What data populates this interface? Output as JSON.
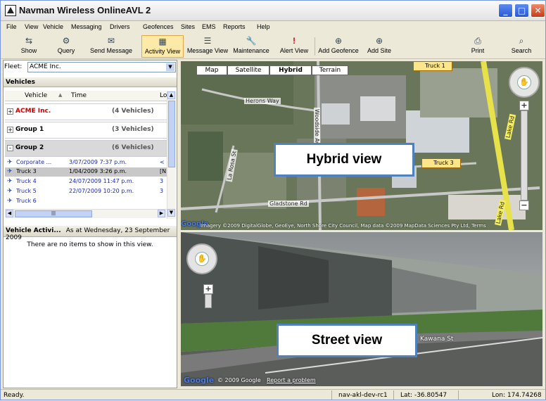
{
  "app": {
    "title": "Navman Wireless OnlineAVL 2"
  },
  "menu": {
    "items": [
      "File",
      "View",
      "Vehicle",
      "Messaging",
      "Drivers",
      "Geofences",
      "Sites",
      "EMS",
      "Reports",
      "Help"
    ]
  },
  "toolbar": {
    "show": "Show",
    "query": "Query",
    "send_message": "Send Message",
    "activity_view": "Activity View",
    "message_view": "Message View",
    "maintenance": "Maintenance",
    "alert_view": "Alert View",
    "add_geofence": "Add Geofence",
    "add_site": "Add Site",
    "print": "Print",
    "search": "Search"
  },
  "fleet": {
    "label": "Fleet:",
    "value": "ACME Inc."
  },
  "vehicles": {
    "header": "Vehicles",
    "columns": {
      "vehicle": "Vehicle",
      "time": "Time",
      "loc": "Lo"
    },
    "groups": [
      {
        "name": "ACME Inc.",
        "count": "(4 Vehicles)",
        "toggle": "+"
      },
      {
        "name": "Group 1",
        "count": "(3 Vehicles)",
        "toggle": "+"
      },
      {
        "name": "Group 2",
        "count": "(6 Vehicles)",
        "toggle": "–"
      }
    ],
    "rows": [
      {
        "name": "Corporate ...",
        "time": "3/07/2009 7:37 p.m.",
        "loc": "<"
      },
      {
        "name": "Truck 3",
        "time": "1/04/2009 3:26 p.m.",
        "loc": "[N"
      },
      {
        "name": "Truck 4",
        "time": "24/07/2009 11:47 p.m.",
        "loc": "3"
      },
      {
        "name": "Truck 5",
        "time": "22/07/2009 10:20 p.m.",
        "loc": "3"
      },
      {
        "name": "Truck 6",
        "time": "",
        "loc": ""
      }
    ]
  },
  "activity": {
    "header": "Vehicle Activi...",
    "as_at": "As at Wednesday, 23 September 2009",
    "empty": "There are no items to show in this view."
  },
  "map": {
    "tabs": [
      "Map",
      "Satellite",
      "Hybrid",
      "Terrain"
    ],
    "selected_tab": "Hybrid",
    "callout": "Hybrid view",
    "roads": [
      "Herons Way",
      "Woodside Ave",
      "La Rosa St",
      "Gladstone Rd",
      "Lake Rd",
      "Kawana St"
    ],
    "vehicle_labels": [
      "Truck 1",
      "Truck 3"
    ],
    "attribution": "Imagery ©2009 DigitalGlobe, GeoEye, North Shore City Council, Map data ©2009 MapData Sciences Pty Ltd, Terms"
  },
  "street": {
    "callout": "Street view",
    "google_copyright": "© 2009 Google",
    "report": "Report a problem",
    "road": "Kawana St"
  },
  "status": {
    "ready": "Ready.",
    "server": "nav-akl-dev-rc1",
    "lat": "Lat: -36.80547",
    "lon": "Lon: 174.74268"
  }
}
